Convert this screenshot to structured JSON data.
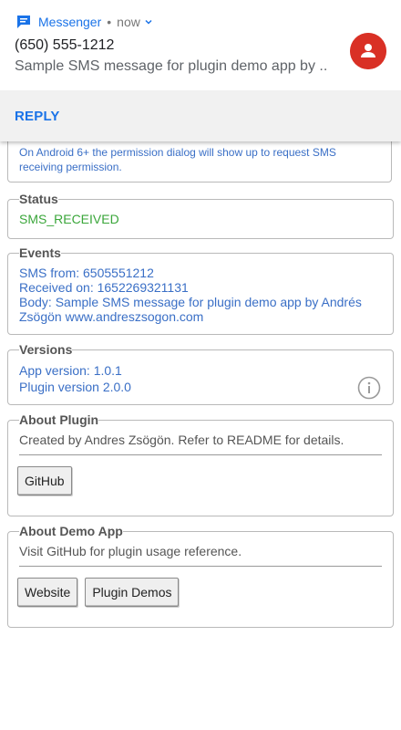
{
  "notification": {
    "app_name": "Messenger",
    "separator": "•",
    "time": "now",
    "title": "(650) 555-1212",
    "text": "Sample SMS message for plugin demo app by Andrés Zsögön www.andreszsogon.com",
    "action_reply": "REPLY",
    "colors": {
      "accent": "#1a73e8",
      "avatar": "#d93025"
    }
  },
  "intro": {
    "text": "On Android 6+ the permission dialog will show up to request SMS receiving permission."
  },
  "status": {
    "legend": "Status",
    "value": "SMS_RECEIVED",
    "color": "#3aa63a"
  },
  "events": {
    "legend": "Events",
    "lines": [
      "SMS from: 6505551212",
      "Received on: 1652269321131",
      "Body: Sample SMS message for plugin demo app by Andrés Zsögön www.andreszsogon.com"
    ]
  },
  "versions": {
    "legend": "Versions",
    "app_version": "App version: 1.0.1",
    "plugin_version": "Plugin version 2.0.0",
    "icon": "info-icon"
  },
  "about_plugin": {
    "legend": "About Plugin",
    "description": "Created by Andres Zsögön. Refer to README for details.",
    "button": "GitHub"
  },
  "about_demo": {
    "legend": "About Demo App",
    "description": "Visit GitHub for plugin usage reference.",
    "buttons": [
      "Website",
      "Plugin Demos"
    ]
  }
}
